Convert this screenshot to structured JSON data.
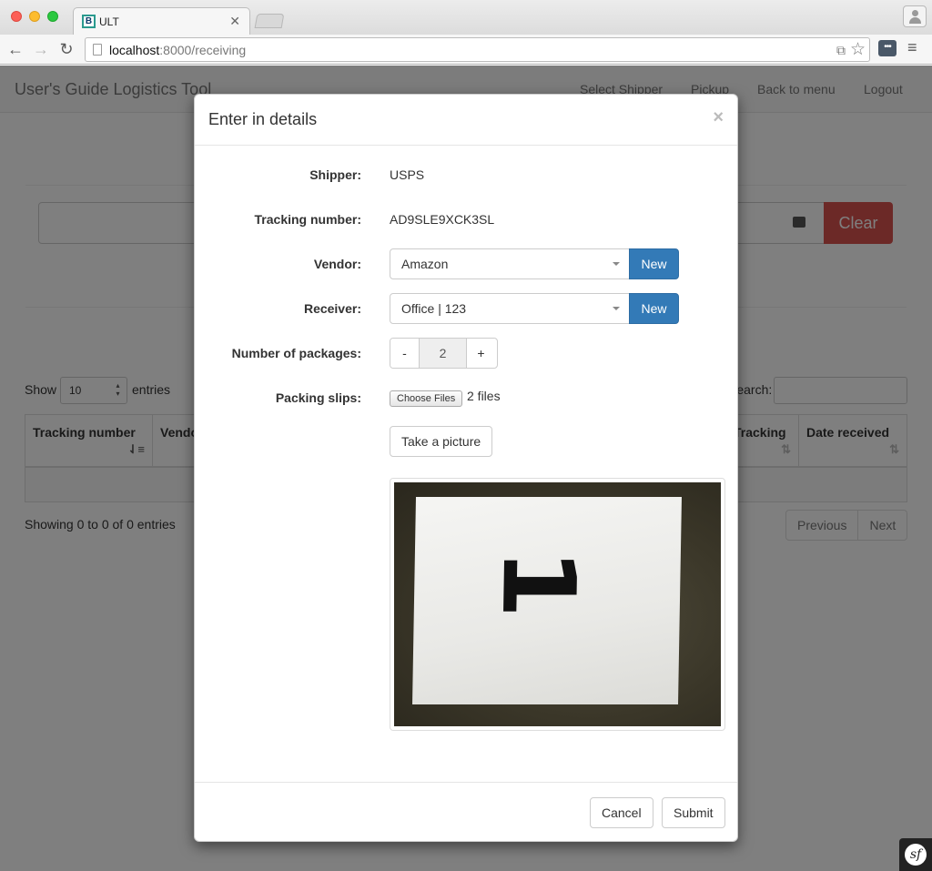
{
  "browser": {
    "tab_title": "ULT",
    "tab_favicon_letter": "B",
    "url_host": "localhost",
    "url_rest": ":8000/receiving"
  },
  "navbar": {
    "brand": "User's Guide Logistics Tool",
    "links": [
      "Select Shipper",
      "Pickup",
      "Back to menu",
      "Logout"
    ]
  },
  "scan": {
    "clear_label": "Clear"
  },
  "table_controls": {
    "show_label": "Show",
    "length_value": "10",
    "entries_label": "entries",
    "search_label": "Search:"
  },
  "table": {
    "columns": [
      "Tracking number",
      "Vendor",
      "Tracking",
      "Date received"
    ],
    "info": "Showing 0 to 0 of 0 entries",
    "prev_label": "Previous",
    "next_label": "Next"
  },
  "modal": {
    "title": "Enter in details",
    "close_glyph": "×",
    "shipper_label": "Shipper:",
    "shipper_value": "USPS",
    "tracking_label": "Tracking number:",
    "tracking_value": "AD9SLE9XCK3SL",
    "vendor_label": "Vendor:",
    "vendor_value": "Amazon",
    "receiver_label": "Receiver:",
    "receiver_value": "Office | 123",
    "new_label": "New",
    "packages_label": "Number of packages:",
    "packages_minus": "-",
    "packages_value": "2",
    "packages_plus": "+",
    "slips_label": "Packing slips:",
    "choose_files_label": "Choose Files",
    "files_count": "2 files",
    "take_picture_label": "Take a picture",
    "photo_digit": "1",
    "cancel_label": "Cancel",
    "submit_label": "Submit"
  },
  "colors": {
    "primary": "#337ab7",
    "danger": "#d9534f"
  },
  "icons": {
    "back": "arrow-left-icon",
    "forward": "arrow-right-icon",
    "reload": "reload-icon",
    "bookmark": "star-icon",
    "camera": "video-camera-icon",
    "menu": "hamburger-menu-icon",
    "symfony": "symfony-logo-icon"
  }
}
